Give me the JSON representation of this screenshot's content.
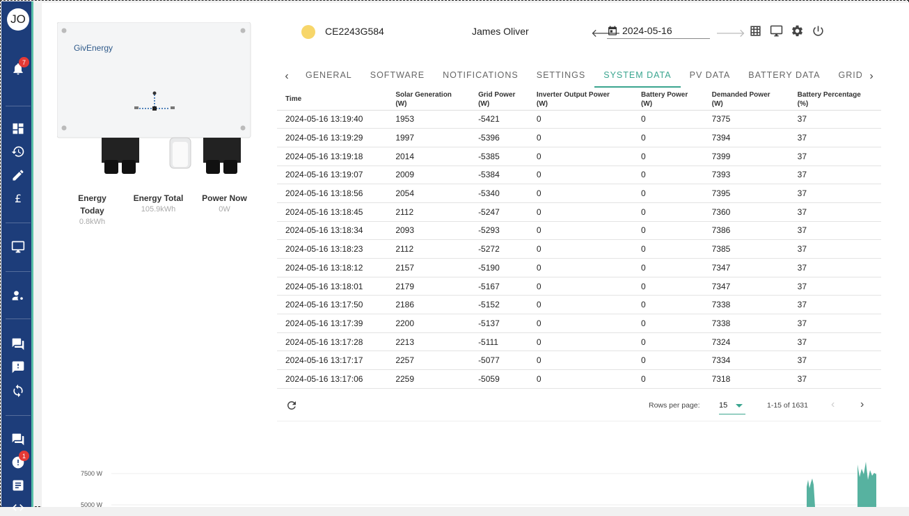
{
  "user": {
    "initials": "JO"
  },
  "sidebar": {
    "notification_count": "7",
    "alert_count": "1"
  },
  "device": {
    "brand": "GivEnergy",
    "serial": "CE2243G584",
    "owner": "James Oliver",
    "status_color": "#f7d66a"
  },
  "date_picker": {
    "value": "2024-05-16"
  },
  "stats": [
    {
      "label": "Energy Today",
      "value": "0.8kWh"
    },
    {
      "label": "Energy Total",
      "value": "105.9kWh"
    },
    {
      "label": "Power Now",
      "value": "0W"
    }
  ],
  "tabs": [
    "GENERAL",
    "SOFTWARE",
    "NOTIFICATIONS",
    "SETTINGS",
    "SYSTEM DATA",
    "PV DATA",
    "BATTERY DATA",
    "GRID DATA"
  ],
  "active_tab": "SYSTEM DATA",
  "table": {
    "columns": [
      {
        "line1": "Time",
        "line2": ""
      },
      {
        "line1": "Solar Generation",
        "line2": "(W)"
      },
      {
        "line1": "Grid Power",
        "line2": "(W)"
      },
      {
        "line1": "Inverter Output Power",
        "line2": "(W)"
      },
      {
        "line1": "Battery Power",
        "line2": "(W)"
      },
      {
        "line1": "Demanded Power",
        "line2": "(W)"
      },
      {
        "line1": "Battery Percentage",
        "line2": "(%)"
      }
    ],
    "rows": [
      [
        "2024-05-16 13:19:40",
        "1953",
        "-5421",
        "0",
        "0",
        "7375",
        "37"
      ],
      [
        "2024-05-16 13:19:29",
        "1997",
        "-5396",
        "0",
        "0",
        "7394",
        "37"
      ],
      [
        "2024-05-16 13:19:18",
        "2014",
        "-5385",
        "0",
        "0",
        "7399",
        "37"
      ],
      [
        "2024-05-16 13:19:07",
        "2009",
        "-5384",
        "0",
        "0",
        "7393",
        "37"
      ],
      [
        "2024-05-16 13:18:56",
        "2054",
        "-5340",
        "0",
        "0",
        "7395",
        "37"
      ],
      [
        "2024-05-16 13:18:45",
        "2112",
        "-5247",
        "0",
        "0",
        "7360",
        "37"
      ],
      [
        "2024-05-16 13:18:34",
        "2093",
        "-5293",
        "0",
        "0",
        "7386",
        "37"
      ],
      [
        "2024-05-16 13:18:23",
        "2112",
        "-5272",
        "0",
        "0",
        "7385",
        "37"
      ],
      [
        "2024-05-16 13:18:12",
        "2157",
        "-5190",
        "0",
        "0",
        "7347",
        "37"
      ],
      [
        "2024-05-16 13:18:01",
        "2179",
        "-5167",
        "0",
        "0",
        "7347",
        "37"
      ],
      [
        "2024-05-16 13:17:50",
        "2186",
        "-5152",
        "0",
        "0",
        "7338",
        "37"
      ],
      [
        "2024-05-16 13:17:39",
        "2200",
        "-5137",
        "0",
        "0",
        "7338",
        "37"
      ],
      [
        "2024-05-16 13:17:28",
        "2213",
        "-5111",
        "0",
        "0",
        "7324",
        "37"
      ],
      [
        "2024-05-16 13:17:17",
        "2257",
        "-5077",
        "0",
        "0",
        "7334",
        "37"
      ],
      [
        "2024-05-16 13:17:06",
        "2259",
        "-5059",
        "0",
        "0",
        "7318",
        "37"
      ]
    ]
  },
  "pagination": {
    "rows_per_page_label": "Rows per page:",
    "rows_per_page": "15",
    "range": "1-15 of 1631"
  },
  "chart": {
    "y_ticks": [
      "7500 W",
      "5000 W"
    ],
    "accent": "#3aa58f"
  }
}
